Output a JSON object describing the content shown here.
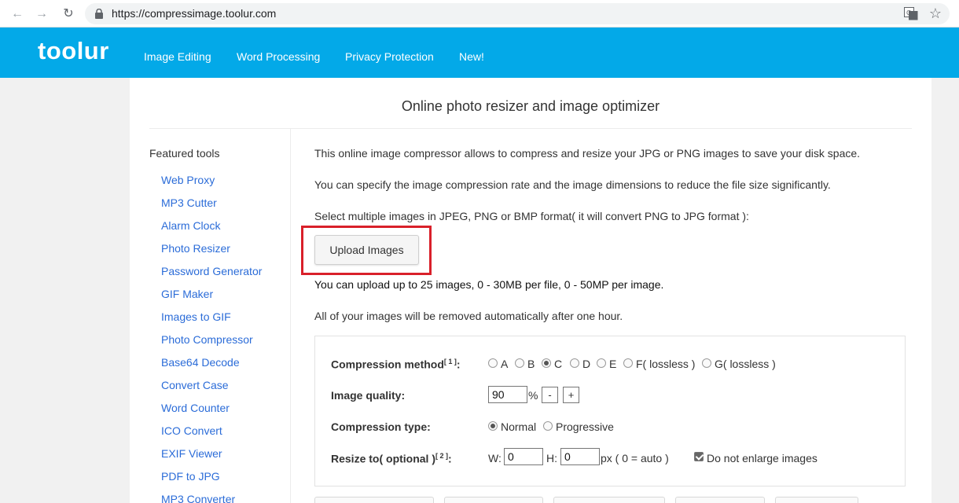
{
  "browser": {
    "url": "https://compressimage.toolur.com"
  },
  "header": {
    "logo": "toolur",
    "nav": [
      "Image Editing",
      "Word Processing",
      "Privacy Protection",
      "New!"
    ]
  },
  "page": {
    "title": "Online photo resizer and image optimizer"
  },
  "sidebar": {
    "title": "Featured tools",
    "items": [
      "Web Proxy",
      "MP3 Cutter",
      "Alarm Clock",
      "Photo Resizer",
      "Password Generator",
      "GIF Maker",
      "Images to GIF",
      "Photo Compressor",
      "Base64 Decode",
      "Convert Case",
      "Word Counter",
      "ICO Convert",
      "EXIF Viewer",
      "PDF to JPG",
      "MP3 Converter"
    ]
  },
  "main": {
    "intro1": "This online image compressor allows to compress and resize your JPG or PNG images to save your disk space.",
    "intro2": "You can specify the image compression rate and the image dimensions to reduce the file size significantly.",
    "intro3": "Select multiple images in JPEG, PNG or BMP format( it will convert PNG to JPG format ):",
    "upload_label": "Upload Images",
    "limits": "You can upload up to 25 images, 0 - 30MB per file, 0 - 50MP per image.",
    "removal_note": "All of your images will be removed automatically after one hour."
  },
  "options": {
    "method_label": "Compression method",
    "method_ref": "[ 1 ]",
    "methods": [
      "A",
      "B",
      "C",
      "D",
      "E",
      "F( lossless )",
      "G( lossless )"
    ],
    "method_selected": "C",
    "quality_label": "Image quality:",
    "quality_value": "90",
    "quality_unit": "%",
    "minus": "-",
    "plus": "+",
    "type_label": "Compression type:",
    "type_normal": "Normal",
    "type_progressive": "Progressive",
    "type_selected": "Normal",
    "resize_label": "Resize to( optional )",
    "resize_ref": "[ 2 ]",
    "colon": ":",
    "w_label": "W:",
    "w_value": "0",
    "h_label": "H:",
    "h_value": "0",
    "px_note": "px ( 0 = auto )",
    "no_enlarge": "Do not enlarge images",
    "no_enlarge_checked": true
  },
  "colors": {
    "header_bg": "#03a9e8",
    "link": "#2b6cd8",
    "highlight": "#d9202a"
  }
}
